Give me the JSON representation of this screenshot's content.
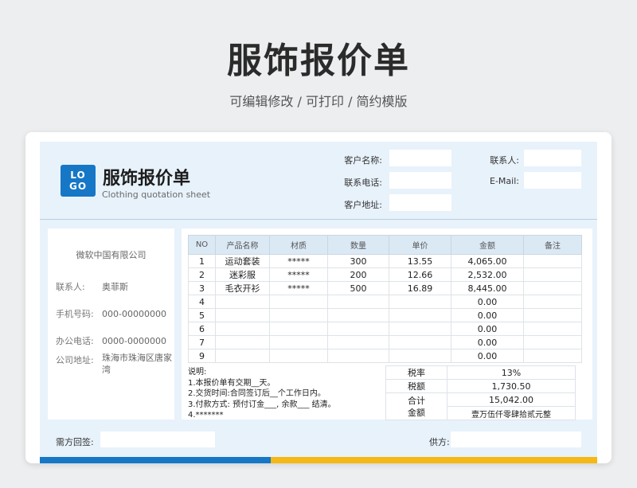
{
  "page": {
    "title": "服饰报价单",
    "subtitle": "可编辑修改 /  可打印  /  简约模版"
  },
  "header": {
    "logo_line1": "LO",
    "logo_line2": "GO",
    "title": "服饰报价单",
    "subtitle_en": "Clothing quotation sheet",
    "customer_name_label": "客户名称:",
    "customer_phone_label": "联系电话:",
    "customer_address_label": "客户地址:",
    "contact_label": "联系人:",
    "email_label": "E-Mail:"
  },
  "company": {
    "name": "微软中国有限公司",
    "contact_label": "联系人:",
    "contact_value": "奥菲斯",
    "mobile_label": "手机号码:",
    "mobile_value": "000-00000000",
    "office_label": "办公电话:",
    "office_value": "0000-0000000",
    "address_label": "公司地址:",
    "address_value": "珠海市珠海区唐家湾"
  },
  "table": {
    "headers": [
      "NO",
      "产品名称",
      "材质",
      "数量",
      "单价",
      "金额",
      "备注"
    ],
    "rows": [
      [
        "1",
        "运动套装",
        "*****",
        "300",
        "13.55",
        "4,065.00",
        ""
      ],
      [
        "2",
        "迷彩服",
        "*****",
        "200",
        "12.66",
        "2,532.00",
        ""
      ],
      [
        "3",
        "毛衣开衫",
        "*****",
        "500",
        "16.89",
        "8,445.00",
        ""
      ],
      [
        "4",
        "",
        "",
        "",
        "",
        "0.00",
        ""
      ],
      [
        "5",
        "",
        "",
        "",
        "",
        "0.00",
        ""
      ],
      [
        "6",
        "",
        "",
        "",
        "",
        "0.00",
        ""
      ],
      [
        "7",
        "",
        "",
        "",
        "",
        "0.00",
        ""
      ],
      [
        "9",
        "",
        "",
        "",
        "",
        "0.00",
        ""
      ]
    ]
  },
  "notes": {
    "title": "说明:",
    "line1": "1.本报价单有交期__天。",
    "line2": "2.交货时间:合同签订后__个工作日内。",
    "line3": "3.付款方式:  预付订金___,  余款___ 结清。",
    "line4": "4.*******"
  },
  "totals": {
    "tax_rate_label": "税率",
    "tax_rate_value": "13%",
    "tax_label": "税额",
    "tax_value": "1,730.50",
    "total_label_1": "合计",
    "total_label_2": "金额",
    "total_value": "15,042.00",
    "total_caps": "壹万伍仟零肆拾贰元整"
  },
  "footer": {
    "buyer_sign_label": "需方回签:",
    "supplier_label": "供方:"
  },
  "colors": {
    "accent_blue": "#1677c6",
    "accent_yellow": "#f5b814",
    "caps_red": "#e03434"
  }
}
